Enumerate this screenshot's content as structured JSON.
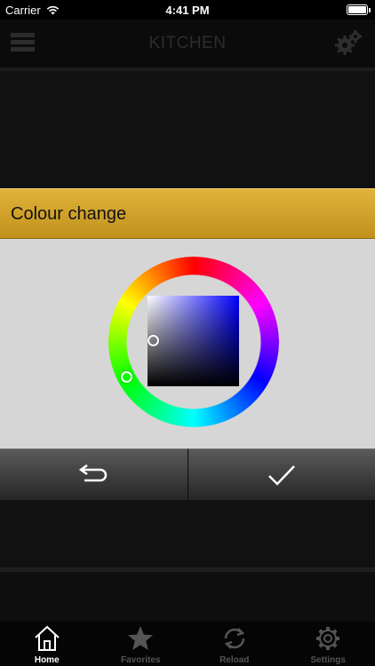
{
  "status_bar": {
    "carrier": "Carrier",
    "time": "4:41 PM",
    "battery_level": 1.0
  },
  "header": {
    "title": "KITCHEN",
    "menu_icon": "hamburger-menu-icon",
    "settings_icon": "gear-icon"
  },
  "dialog": {
    "title": "Colour change",
    "cancel_icon": "undo-arrow-icon",
    "confirm_icon": "checkmark-icon",
    "selected_hue_color": "#0000ff",
    "header_color": "#d4a52e"
  },
  "tabs": [
    {
      "label": "Home",
      "icon": "home-icon",
      "active": true
    },
    {
      "label": "Favorites",
      "icon": "star-icon",
      "active": false
    },
    {
      "label": "Reload",
      "icon": "reload-icon",
      "active": false
    },
    {
      "label": "Settings",
      "icon": "gear-icon",
      "active": false
    }
  ]
}
